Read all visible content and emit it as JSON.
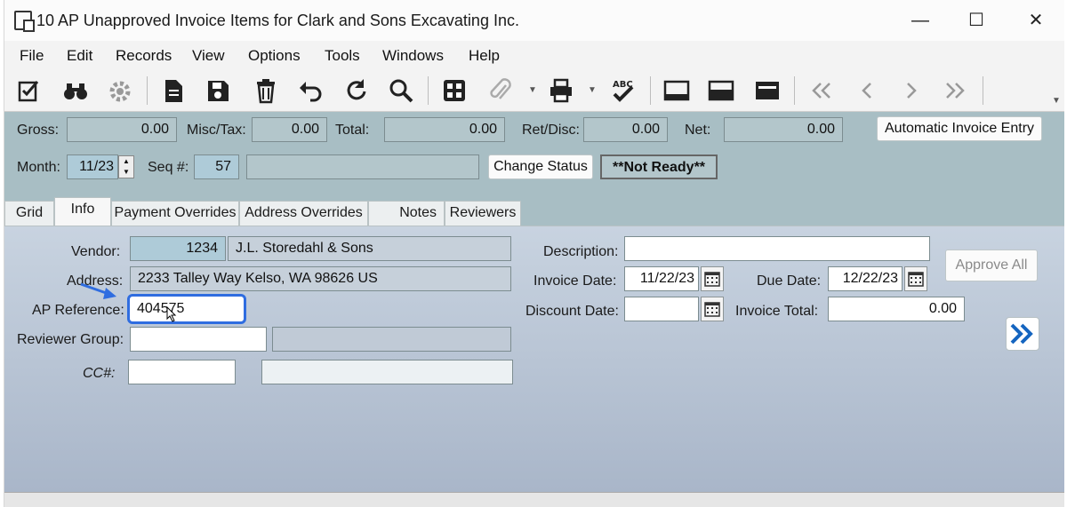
{
  "window": {
    "title": "10 AP Unapproved Invoice Items for Clark and Sons Excavating Inc.",
    "controls": {
      "minimize": "—",
      "maximize": "☐",
      "close": "✕"
    }
  },
  "menu": [
    "File",
    "Edit",
    "Records",
    "View",
    "Options",
    "Tools",
    "Windows",
    "Help"
  ],
  "toolbar": {
    "icons": [
      "edit-checklist-icon",
      "binoculars-icon",
      "settings-gear-icon",
      "document-icon",
      "save-icon",
      "delete-trash-icon",
      "undo-icon",
      "refresh-icon",
      "search-icon",
      "calculator-icon",
      "attachment-icon",
      "print-icon",
      "spellcheck-icon",
      "layout-bottom-icon",
      "layout-middle-icon",
      "layout-top-icon",
      "first-record-icon",
      "prev-record-icon",
      "next-record-icon",
      "last-record-icon"
    ],
    "spell_label": "ABC"
  },
  "header": {
    "gross_label": "Gross:",
    "gross_value": "0.00",
    "misc_label": "Misc/Tax:",
    "misc_value": "0.00",
    "total_label": "Total:",
    "total_value": "0.00",
    "ret_label": "Ret/Disc:",
    "ret_value": "0.00",
    "net_label": "Net:",
    "net_value": "0.00",
    "auto_invoice_button": "Automatic Invoice Entry",
    "month_label": "Month:",
    "month_value": "11/23",
    "seq_label": "Seq #:",
    "seq_value": "57",
    "change_status_button": "Change Status",
    "status_value": "**Not Ready**"
  },
  "tabs": [
    {
      "label": "Grid",
      "active": false
    },
    {
      "label": "Info",
      "active": true
    },
    {
      "label": "Payment Overrides",
      "active": false
    },
    {
      "label": "Address Overrides",
      "active": false
    },
    {
      "label": "Notes",
      "active": false
    },
    {
      "label": "Reviewers",
      "active": false
    }
  ],
  "info": {
    "vendor_label": "Vendor:",
    "vendor_id": "1234",
    "vendor_name": "J.L. Storedahl & Sons",
    "address_label": "Address:",
    "address_value": "2233 Talley Way  Kelso, WA  98626  US",
    "apref_label": "AP Reference:",
    "apref_value": "404575",
    "reviewer_label": "Reviewer Group:",
    "reviewer_value": "",
    "reviewer_desc": "",
    "cc_label": "CC#:",
    "cc_value": "",
    "cc_desc": "",
    "description_label": "Description:",
    "description_value": "",
    "invoice_date_label": "Invoice Date:",
    "invoice_date_value": "11/22/23",
    "due_date_label": "Due Date:",
    "due_date_value": "12/22/23",
    "discount_date_label": "Discount Date:",
    "discount_date_value": "",
    "invoice_total_label": "Invoice Total:",
    "invoice_total_value": "0.00",
    "approve_all_button": "Approve All"
  }
}
